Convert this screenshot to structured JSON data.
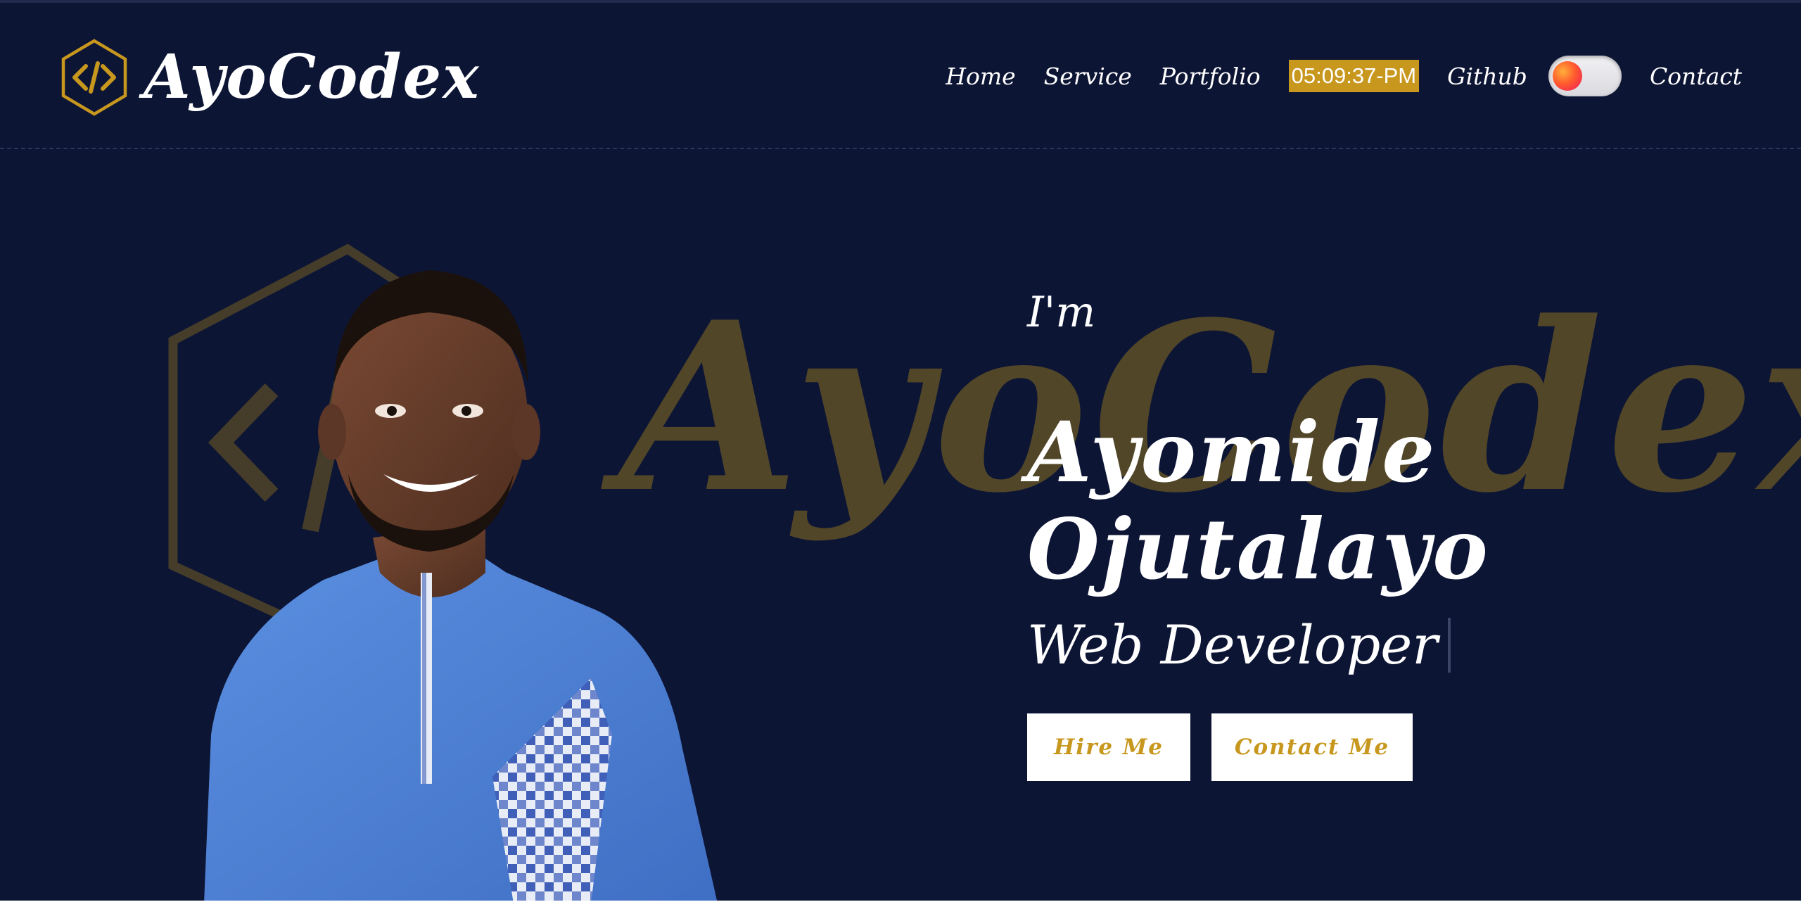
{
  "header": {
    "brand_name": "AyoCodex",
    "nav": {
      "home": "Home",
      "service": "Service",
      "portfolio": "Portfolio",
      "clock": "05:09:37-PM",
      "github": "Github",
      "contact": "Contact"
    },
    "theme_toggle_icon": "toggle-switch"
  },
  "hero": {
    "watermark_text": "AyoCodex",
    "intro": "I'm",
    "name_line1": "Ayomide",
    "name_line2": "Ojutalayo",
    "role": "Web Developer",
    "buttons": {
      "hire": "Hire Me",
      "contact": "Contact Me"
    }
  },
  "colors": {
    "background": "#0d1535",
    "accent": "#c8971e",
    "text": "#ffffff"
  }
}
